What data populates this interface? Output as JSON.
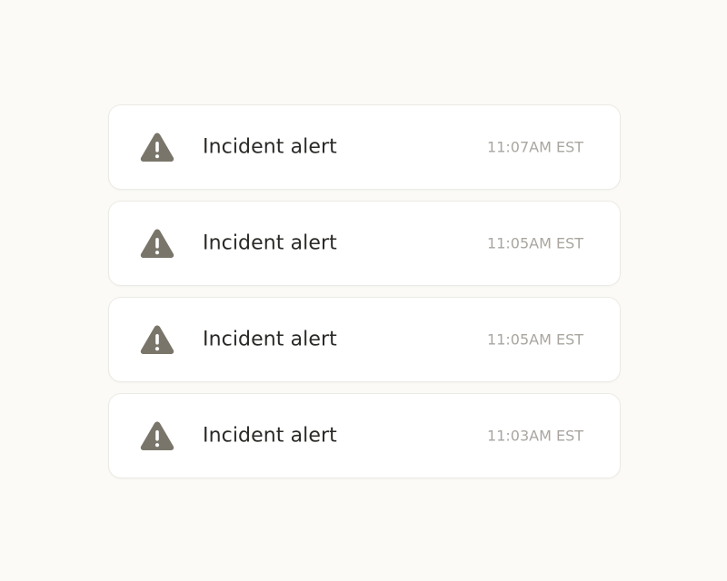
{
  "alerts": [
    {
      "title": "Incident alert",
      "time": "11:07AM EST",
      "icon": "warning-triangle-icon"
    },
    {
      "title": "Incident alert",
      "time": "11:05AM EST",
      "icon": "warning-triangle-icon"
    },
    {
      "title": "Incident alert",
      "time": "11:05AM EST",
      "icon": "warning-triangle-icon"
    },
    {
      "title": "Incident alert",
      "time": "11:03AM EST",
      "icon": "warning-triangle-icon"
    }
  ],
  "colors": {
    "background": "#fbfaf6",
    "card": "#ffffff",
    "icon": "#7a756a",
    "title": "#2b2a27",
    "time": "#a9a6a0"
  }
}
